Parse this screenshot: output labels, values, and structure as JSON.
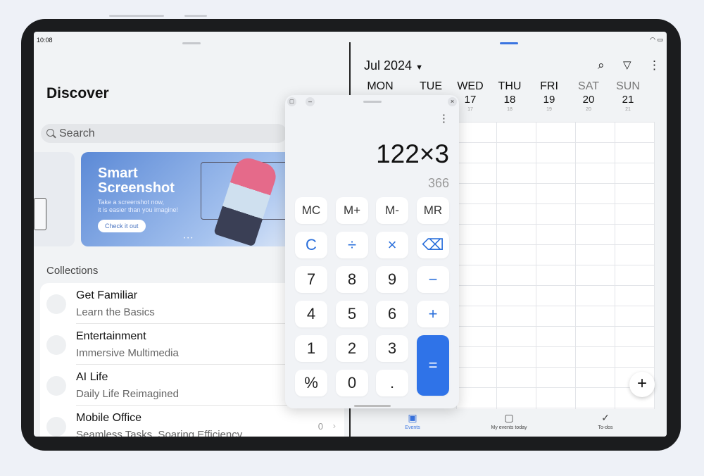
{
  "status_bar": {
    "time": "10:08"
  },
  "discover": {
    "title": "Discover",
    "search_placeholder": "Search",
    "banner": {
      "title_line1": "Smart",
      "title_line2": "Screenshot",
      "subtitle_line1": "Take a screenshot now,",
      "subtitle_line2": "it is easier than you imagine!",
      "button": "Check it out"
    },
    "collections_label": "Collections",
    "items": [
      {
        "title": "Get Familiar",
        "subtitle": "Learn the Basics",
        "icon": "hand-icon"
      },
      {
        "title": "Entertainment",
        "subtitle": "Immersive Multimedia",
        "icon": "film-reel-icon"
      },
      {
        "title": "AI Life",
        "subtitle": "Daily Life Reimagined",
        "icon": "lightbulb-icon"
      },
      {
        "title": "Mobile Office",
        "subtitle": "Seamless Tasks, Soaring Efficiency",
        "icon": "briefcase-icon",
        "count": "0"
      }
    ]
  },
  "calendar": {
    "month": "Jul 2024",
    "days": [
      {
        "name": "MON",
        "date": ""
      },
      {
        "name": "TUE",
        "date": ""
      },
      {
        "name": "WED",
        "date": "17",
        "lunar": "17"
      },
      {
        "name": "THU",
        "date": "18",
        "lunar": "18"
      },
      {
        "name": "FRI",
        "date": "19",
        "lunar": "19"
      },
      {
        "name": "SAT",
        "date": "20",
        "lunar": "20"
      },
      {
        "name": "SUN",
        "date": "21",
        "lunar": "21"
      }
    ],
    "nav": [
      {
        "label": "Events",
        "icon": "calendar-icon",
        "active": true
      },
      {
        "label": "My events today",
        "icon": "calendar-day-icon",
        "day": "1"
      },
      {
        "label": "To-dos",
        "icon": "check-circle-icon"
      }
    ],
    "accent": "#3a74e0"
  },
  "calculator": {
    "expression": "122×3",
    "result": "366",
    "memory": [
      "MC",
      "M+",
      "M-",
      "MR"
    ],
    "keys": [
      [
        "C",
        "÷",
        "×",
        "⌫"
      ],
      [
        "7",
        "8",
        "9",
        "−"
      ],
      [
        "4",
        "5",
        "6",
        "+"
      ],
      [
        "1",
        "2",
        "3",
        ""
      ],
      [
        "%",
        "0",
        ".",
        ""
      ]
    ],
    "equals": "=",
    "accent": "#2f73e8"
  }
}
